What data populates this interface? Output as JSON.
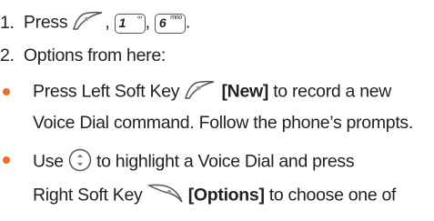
{
  "steps": [
    {
      "number": "1.",
      "press": "Press",
      "sep1": ",",
      "sep2": ",",
      "end": "."
    },
    {
      "number": "2.",
      "text": "Options from here:"
    }
  ],
  "keys": [
    {
      "main": "1",
      "sub": "∞"
    },
    {
      "main": "6",
      "sub": "mno"
    }
  ],
  "bullets": [
    {
      "lead": "Press Left Soft Key",
      "bold": "[New]",
      "tail": "to record a new",
      "line2": "Voice Dial command. Follow the phone’s prompts."
    },
    {
      "lead": "Use",
      "tail": "to highlight a Voice Dial and press",
      "line2_lead": "Right Soft Key",
      "bold": "[Options]",
      "line2_tail": "to choose one of"
    }
  ],
  "colors": {
    "bullet": "#e8702a",
    "text": "#222222"
  },
  "icons": [
    "left-softkey-icon",
    "navigation-key-icon",
    "right-softkey-icon"
  ]
}
